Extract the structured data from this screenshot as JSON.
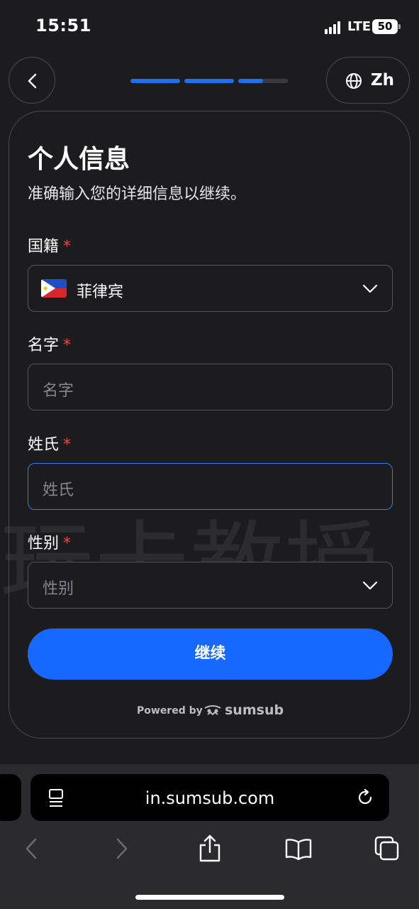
{
  "status": {
    "time": "15:51",
    "network": "LTE",
    "battery": "50"
  },
  "nav": {
    "lang_label": "Zh",
    "progress": [
      1.0,
      1.0,
      0.5
    ]
  },
  "form": {
    "title": "个人信息",
    "subtitle": "准确输入您的详细信息以继续。",
    "required_marker": "*",
    "nationality": {
      "label": "国籍",
      "value": "菲律宾",
      "flag": "philippines-flag"
    },
    "first_name": {
      "label": "名字",
      "placeholder": "名字"
    },
    "last_name": {
      "label": "姓氏",
      "placeholder": "姓氏"
    },
    "gender": {
      "label": "性别",
      "placeholder": "性别"
    },
    "continue_label": "继续"
  },
  "powered": {
    "label": "Powered by",
    "brand": "sumsub"
  },
  "watermark": "玩卡教授",
  "browser": {
    "url": "in.sumsub.com"
  },
  "colors": {
    "accent": "#1668ff",
    "required": "#e5484d",
    "background": "#1c1c1f"
  }
}
